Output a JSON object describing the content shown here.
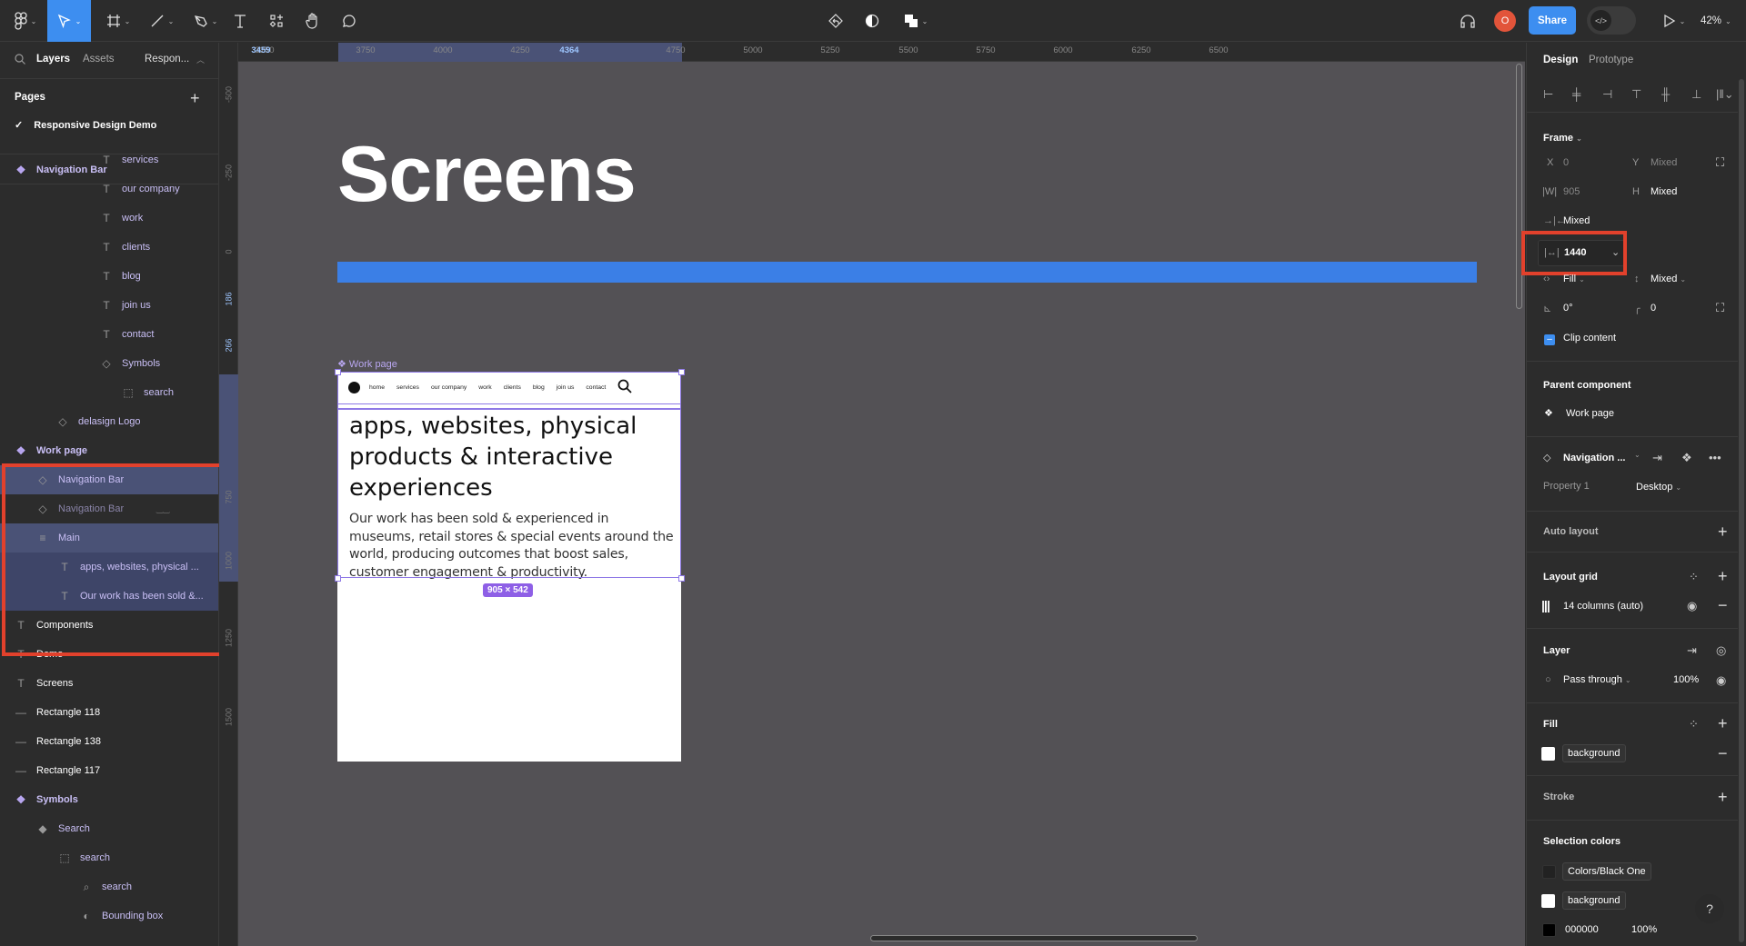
{
  "toolbar": {
    "tools": [
      "main-menu",
      "move",
      "frame",
      "line",
      "pen",
      "text",
      "resources",
      "hand",
      "comment"
    ],
    "center_tools": [
      "undo-history",
      "theme-toggle",
      "boolean-ops"
    ],
    "avatar_initial": "O",
    "share_label": "Share",
    "zoom_label": "42%",
    "colors": {
      "accent": "#3d8ef0",
      "avatar": "#e2543a"
    }
  },
  "left_panel": {
    "tabs": {
      "layers": "Layers",
      "assets": "Assets",
      "page": "Respon..."
    },
    "pages_header": "Pages",
    "current_page": "Responsive Design Demo",
    "sticky_header": "Navigation Bar",
    "layers": [
      {
        "label": "services",
        "icon": "text"
      },
      {
        "label": "our company",
        "icon": "text"
      },
      {
        "label": "work",
        "icon": "text"
      },
      {
        "label": "clients",
        "icon": "text"
      },
      {
        "label": "blog",
        "icon": "text"
      },
      {
        "label": "join us",
        "icon": "text"
      },
      {
        "label": "contact",
        "icon": "text"
      },
      {
        "label": "Symbols",
        "icon": "instance"
      },
      {
        "label": "search",
        "icon": "slice"
      },
      {
        "label": "delasign Logo",
        "icon": "instance"
      },
      {
        "label": "Work page",
        "icon": "component"
      },
      {
        "label": "Navigation Bar",
        "icon": "instance"
      },
      {
        "label": "Navigation Bar",
        "icon": "instance",
        "hidden": true
      },
      {
        "label": "Main",
        "icon": "auto-layout"
      },
      {
        "label": "apps, websites, physical ...",
        "icon": "text"
      },
      {
        "label": "Our work has been sold &...",
        "icon": "text"
      },
      {
        "label": "Components",
        "icon": "text"
      },
      {
        "label": "Demo",
        "icon": "text"
      },
      {
        "label": "Screens",
        "icon": "text"
      },
      {
        "label": "Rectangle 118",
        "icon": "line"
      },
      {
        "label": "Rectangle 138",
        "icon": "line"
      },
      {
        "label": "Rectangle 117",
        "icon": "line"
      },
      {
        "label": "Symbols",
        "icon": "component"
      },
      {
        "label": "Search",
        "icon": "component-main"
      },
      {
        "label": "search",
        "icon": "slice"
      },
      {
        "label": "search",
        "icon": "search"
      },
      {
        "label": "Bounding box",
        "icon": "boolean"
      }
    ]
  },
  "rulers": {
    "horizontal": [
      "3250",
      "3459",
      "3750",
      "4000",
      "4250",
      "4364",
      "4750",
      "5000",
      "5250",
      "5500",
      "5750",
      "6000",
      "6250",
      "6500"
    ],
    "horizontal_selection": [
      "3459",
      "4364"
    ],
    "vertical": [
      "-500",
      "-250",
      "0",
      "186",
      "266",
      "750",
      "1000",
      "1250",
      "1500"
    ],
    "vertical_selection": [
      "186",
      "266"
    ]
  },
  "canvas": {
    "title": "Screens",
    "frame_label": "Work page",
    "nav_links": [
      "home",
      "services",
      "our company",
      "work",
      "clients",
      "blog",
      "join us",
      "contact"
    ],
    "hero_heading": "apps, websites, physical products & interactive experiences",
    "hero_body": "Our work has been sold & experienced in museums, retail stores & special events around the world, producing outcomes that boost sales, customer engagement & productivity.",
    "size_badge": "905 × 542",
    "colors": {
      "blue_bar": "#3b7fe6",
      "selection": "#8e78e6"
    }
  },
  "right_panel": {
    "tabs": {
      "design": "Design",
      "prototype": "Prototype"
    },
    "frame": {
      "header": "Frame",
      "x_label": "X",
      "x_value": "0",
      "y_label": "Y",
      "y_value": "Mixed",
      "w_label": "W",
      "w_value": "905",
      "h_label": "H",
      "h_value": "Mixed",
      "gap_value": "Mixed",
      "min_width_value": "1440",
      "h_sizing": "Fill",
      "v_sizing": "Mixed",
      "rotation": "0°",
      "radius": "0",
      "clip_content_label": "Clip content",
      "clip_content": true
    },
    "parent_component": {
      "header": "Parent component",
      "name": "Work page"
    },
    "instance": {
      "name": "Navigation ...",
      "property_label": "Property 1",
      "property_value": "Desktop"
    },
    "auto_layout": {
      "header": "Auto layout"
    },
    "layout_grid": {
      "header": "Layout grid",
      "value": "14 columns (auto)"
    },
    "layer": {
      "header": "Layer",
      "blend": "Pass through",
      "opacity": "100%"
    },
    "fill": {
      "header": "Fill",
      "style": "background",
      "swatch": "#ffffff"
    },
    "stroke": {
      "header": "Stroke"
    },
    "selection_colors": {
      "header": "Selection colors",
      "items": [
        {
          "label": "Colors/Black One",
          "swatch": "#222222"
        },
        {
          "label": "background",
          "swatch": "#ffffff"
        },
        {
          "label": "000000",
          "swatch": "#000000",
          "opacity": "100%"
        }
      ]
    },
    "help_label": "?"
  }
}
